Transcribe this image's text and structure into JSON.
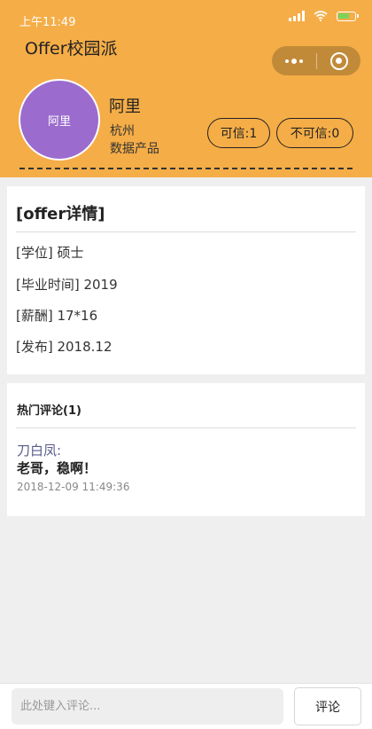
{
  "status_bar": {
    "time": "上午11:49"
  },
  "header": {
    "app_title": "Offer校园派",
    "avatar_text": "阿里",
    "user_name": "阿里",
    "user_city": "杭州",
    "user_role": "数据产品",
    "credible_label": "可信:1",
    "noncredible_label": "不可信:0"
  },
  "detail": {
    "title": "[offer详情]",
    "rows": [
      "[学位] 硕士",
      "[毕业时间] 2019",
      "[薪酬] 17*16",
      "[发布] 2018.12"
    ]
  },
  "comments": {
    "title": "热门评论(1)",
    "items": [
      {
        "author": "刀白凤:",
        "text": "老哥，稳啊！",
        "time": "2018-12-09 11:49:36"
      }
    ]
  },
  "bottom_bar": {
    "input_placeholder": "此处键入评论...",
    "input_value": "",
    "submit_label": "评论"
  },
  "colors": {
    "header_bg": "#f5ad47",
    "avatar_bg": "#9b6bce",
    "comment_author": "#5a5a8c"
  }
}
